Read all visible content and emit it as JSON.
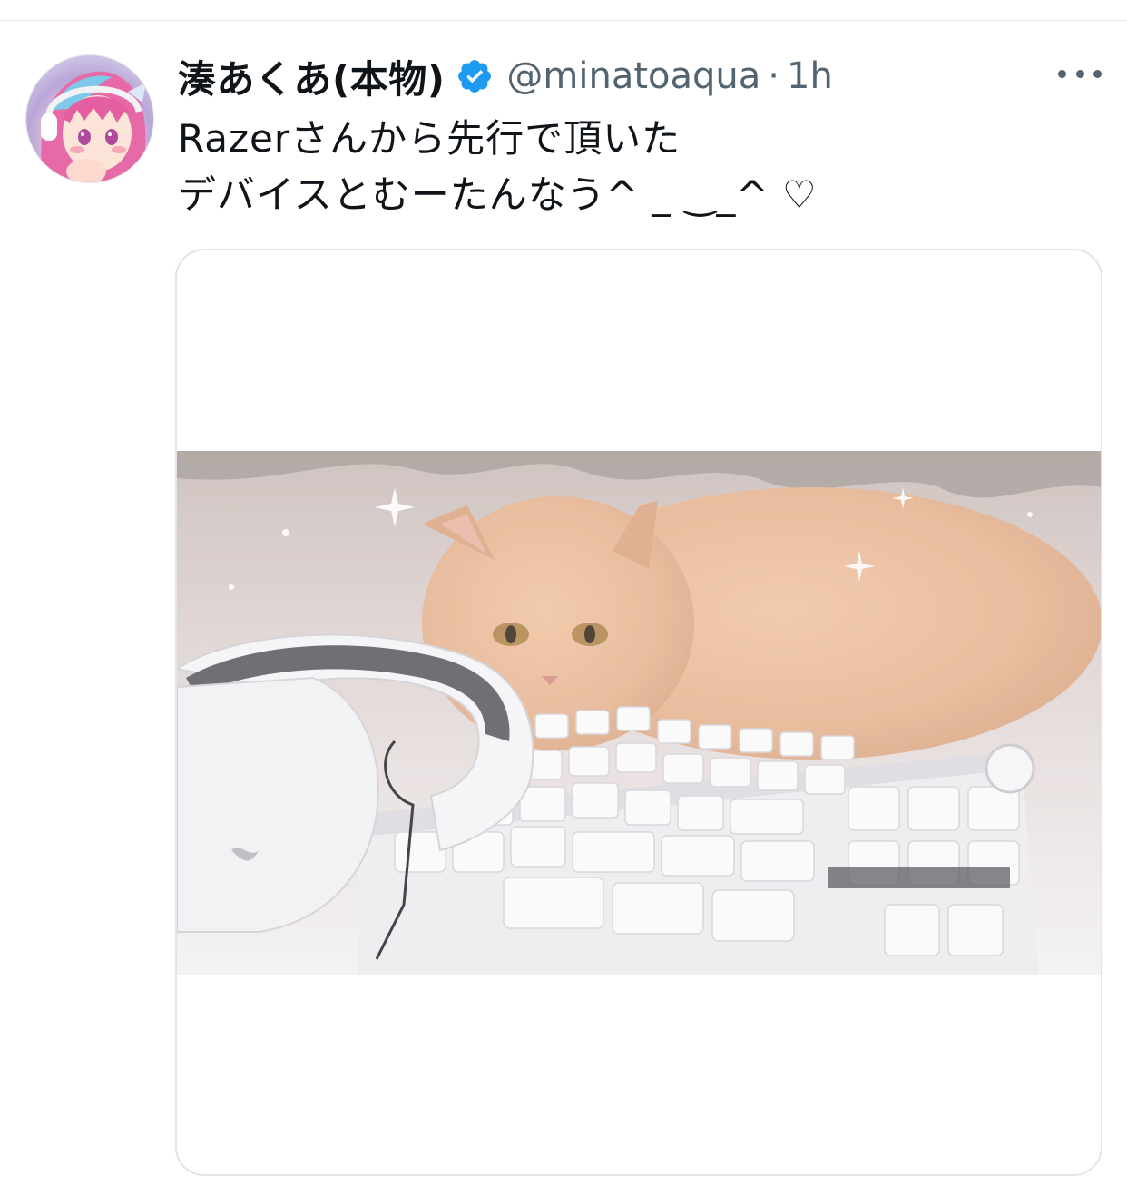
{
  "tweet": {
    "author": {
      "display_name": "湊あくあ(本物)",
      "handle": "@minatoaqua",
      "verified": true
    },
    "separator": "·",
    "time": "1h",
    "text_lines": [
      "Razerさんから先行で頂いた",
      "デバイスとむーたんなう^ _ ‿_^ ♡"
    ],
    "media": {
      "kind": "photo",
      "icon": "cat-keyboard-photo"
    }
  },
  "colors": {
    "text_primary": "#0f1419",
    "text_secondary": "#536471",
    "verified_blue": "#1d9bf0",
    "border": "#e1e4e8"
  },
  "icons": {
    "verified": "verified-badge-icon",
    "more": "more-horizontal-icon"
  }
}
